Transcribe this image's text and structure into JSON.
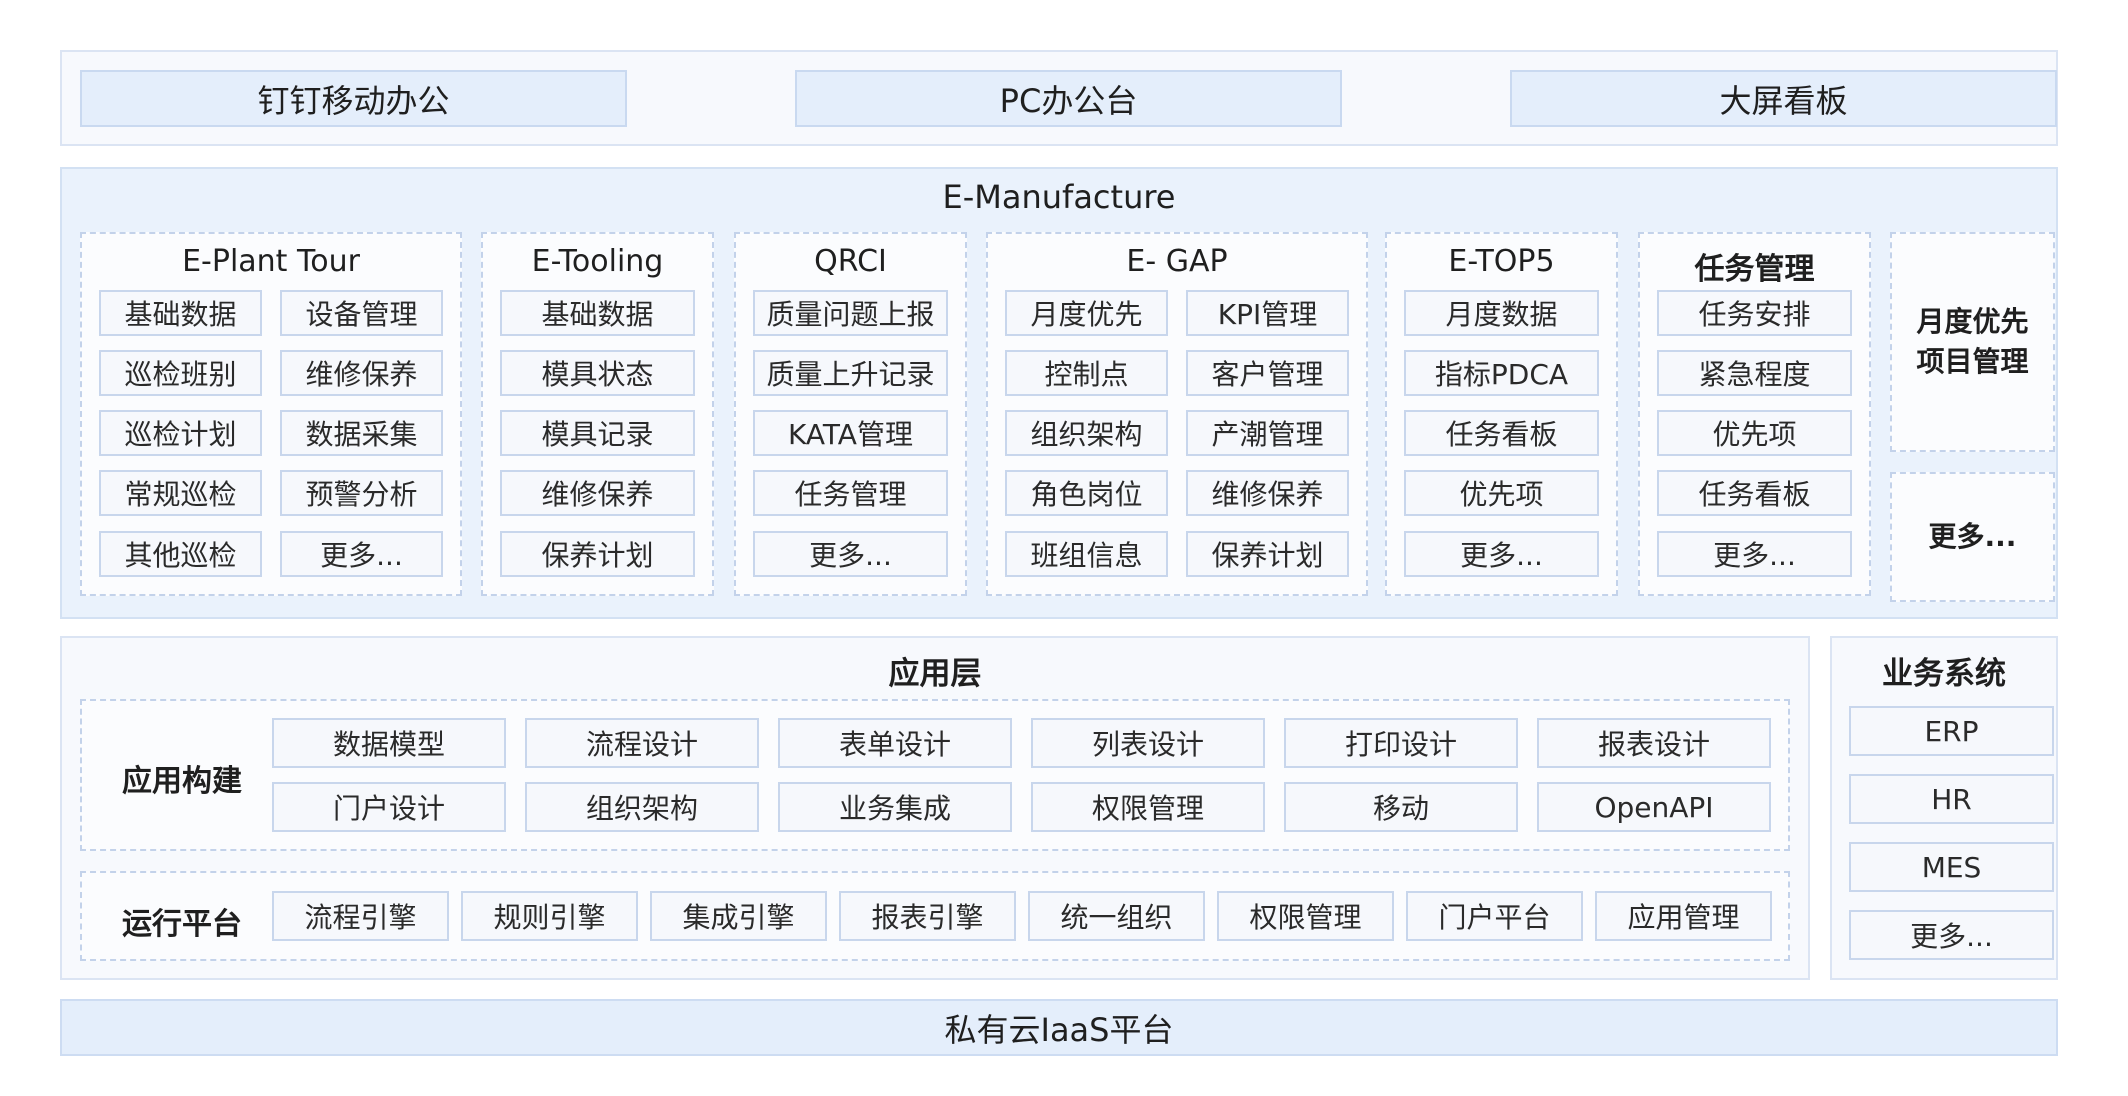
{
  "top": {
    "items": [
      "钉钉移动办公",
      "PC办公台",
      "大屏看板"
    ]
  },
  "emanufacture": {
    "title": "E-Manufacture",
    "plant_tour": {
      "title": "E-Plant Tour",
      "left": [
        "基础数据",
        "巡检班别",
        "巡检计划",
        "常规巡检",
        "其他巡检"
      ],
      "right": [
        "设备管理",
        "维修保养",
        "数据采集",
        "预警分析",
        "更多..."
      ]
    },
    "tooling": {
      "title": "E-Tooling",
      "items": [
        "基础数据",
        "模具状态",
        "模具记录",
        "维修保养",
        "保养计划"
      ]
    },
    "qrci": {
      "title": "QRCI",
      "items": [
        "质量问题上报",
        "质量上升记录",
        "KATA管理",
        "任务管理",
        "更多..."
      ]
    },
    "gap": {
      "title": "E- GAP",
      "left": [
        "月度优先",
        "控制点",
        "组织架构",
        "角色岗位",
        "班组信息"
      ],
      "right": [
        "KPI管理",
        "客户管理",
        "产潮管理",
        "维修保养",
        "保养计划"
      ]
    },
    "top5": {
      "title": "E-TOP5",
      "items": [
        "月度数据",
        "指标PDCA",
        "任务看板",
        "优先项",
        "更多..."
      ]
    },
    "task": {
      "title": "任务管理",
      "items": [
        "任务安排",
        "紧急程度",
        "优先项",
        "任务看板",
        "更多..."
      ]
    },
    "monthly": {
      "line1": "月度优先",
      "line2": "项目管理"
    },
    "more": "更多..."
  },
  "app_layer": {
    "title": "应用层",
    "build": {
      "label": "应用构建",
      "row1": [
        "数据模型",
        "流程设计",
        "表单设计",
        "列表设计",
        "打印设计",
        "报表设计"
      ],
      "row2": [
        "门户设计",
        "组织架构",
        "业务集成",
        "权限管理",
        "移动",
        "OpenAPI"
      ]
    },
    "runtime": {
      "label": "运行平台",
      "items": [
        "流程引擎",
        "规则引擎",
        "集成引擎",
        "报表引擎",
        "统一组织",
        "权限管理",
        "门户平台",
        "应用管理"
      ]
    }
  },
  "business": {
    "title": "业务系统",
    "items": [
      "ERP",
      "HR",
      "MES",
      "更多..."
    ]
  },
  "bottom": {
    "label": "私有云IaaS平台"
  }
}
